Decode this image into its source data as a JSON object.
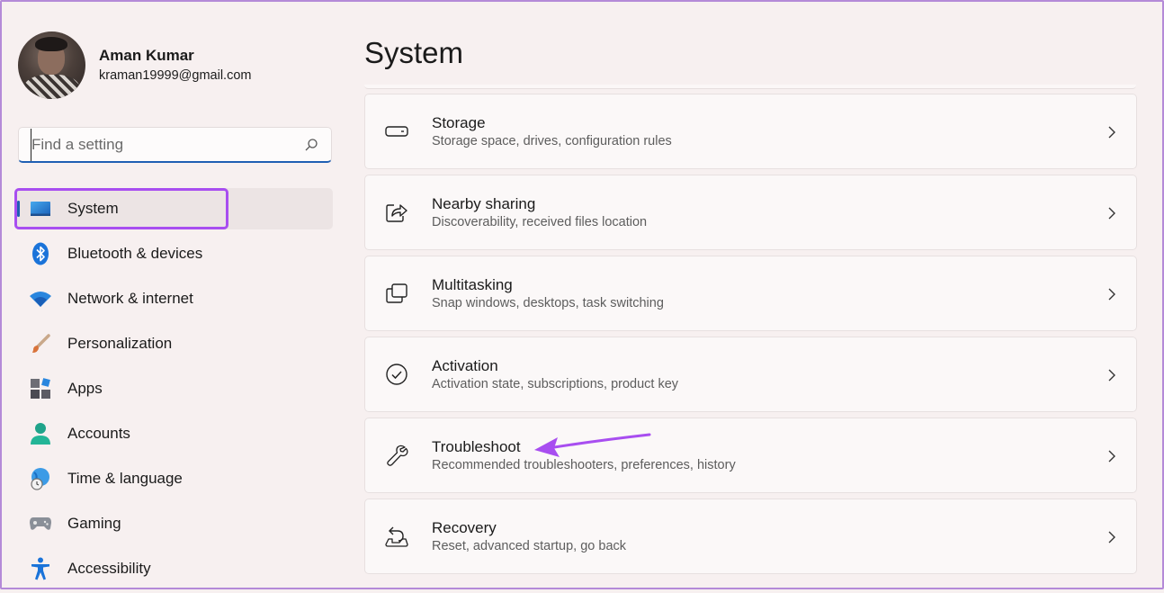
{
  "profile": {
    "name": "Aman Kumar",
    "email": "kraman19999@gmail.com"
  },
  "search": {
    "placeholder": "Find a setting",
    "value": ""
  },
  "sidebar": {
    "items": [
      {
        "label": "System",
        "icon": "system-icon"
      },
      {
        "label": "Bluetooth & devices",
        "icon": "bluetooth-icon"
      },
      {
        "label": "Network & internet",
        "icon": "wifi-icon"
      },
      {
        "label": "Personalization",
        "icon": "brush-icon"
      },
      {
        "label": "Apps",
        "icon": "apps-icon"
      },
      {
        "label": "Accounts",
        "icon": "person-icon"
      },
      {
        "label": "Time & language",
        "icon": "globe-clock-icon"
      },
      {
        "label": "Gaming",
        "icon": "gamepad-icon"
      },
      {
        "label": "Accessibility",
        "icon": "accessibility-icon"
      }
    ],
    "active_index": 0
  },
  "main": {
    "title": "System",
    "cards": [
      {
        "title": "Storage",
        "subtitle": "Storage space, drives, configuration rules",
        "icon": "storage-drive-icon"
      },
      {
        "title": "Nearby sharing",
        "subtitle": "Discoverability, received files location",
        "icon": "share-icon"
      },
      {
        "title": "Multitasking",
        "subtitle": "Snap windows, desktops, task switching",
        "icon": "multitasking-icon"
      },
      {
        "title": "Activation",
        "subtitle": "Activation state, subscriptions, product key",
        "icon": "check-circle-icon"
      },
      {
        "title": "Troubleshoot",
        "subtitle": "Recommended troubleshooters, preferences, history",
        "icon": "wrench-icon"
      },
      {
        "title": "Recovery",
        "subtitle": "Reset, advanced startup, go back",
        "icon": "recovery-icon"
      }
    ]
  },
  "colors": {
    "accent": "#1f5fb3",
    "highlight": "#a84ef0",
    "background": "#f7f0f0"
  }
}
